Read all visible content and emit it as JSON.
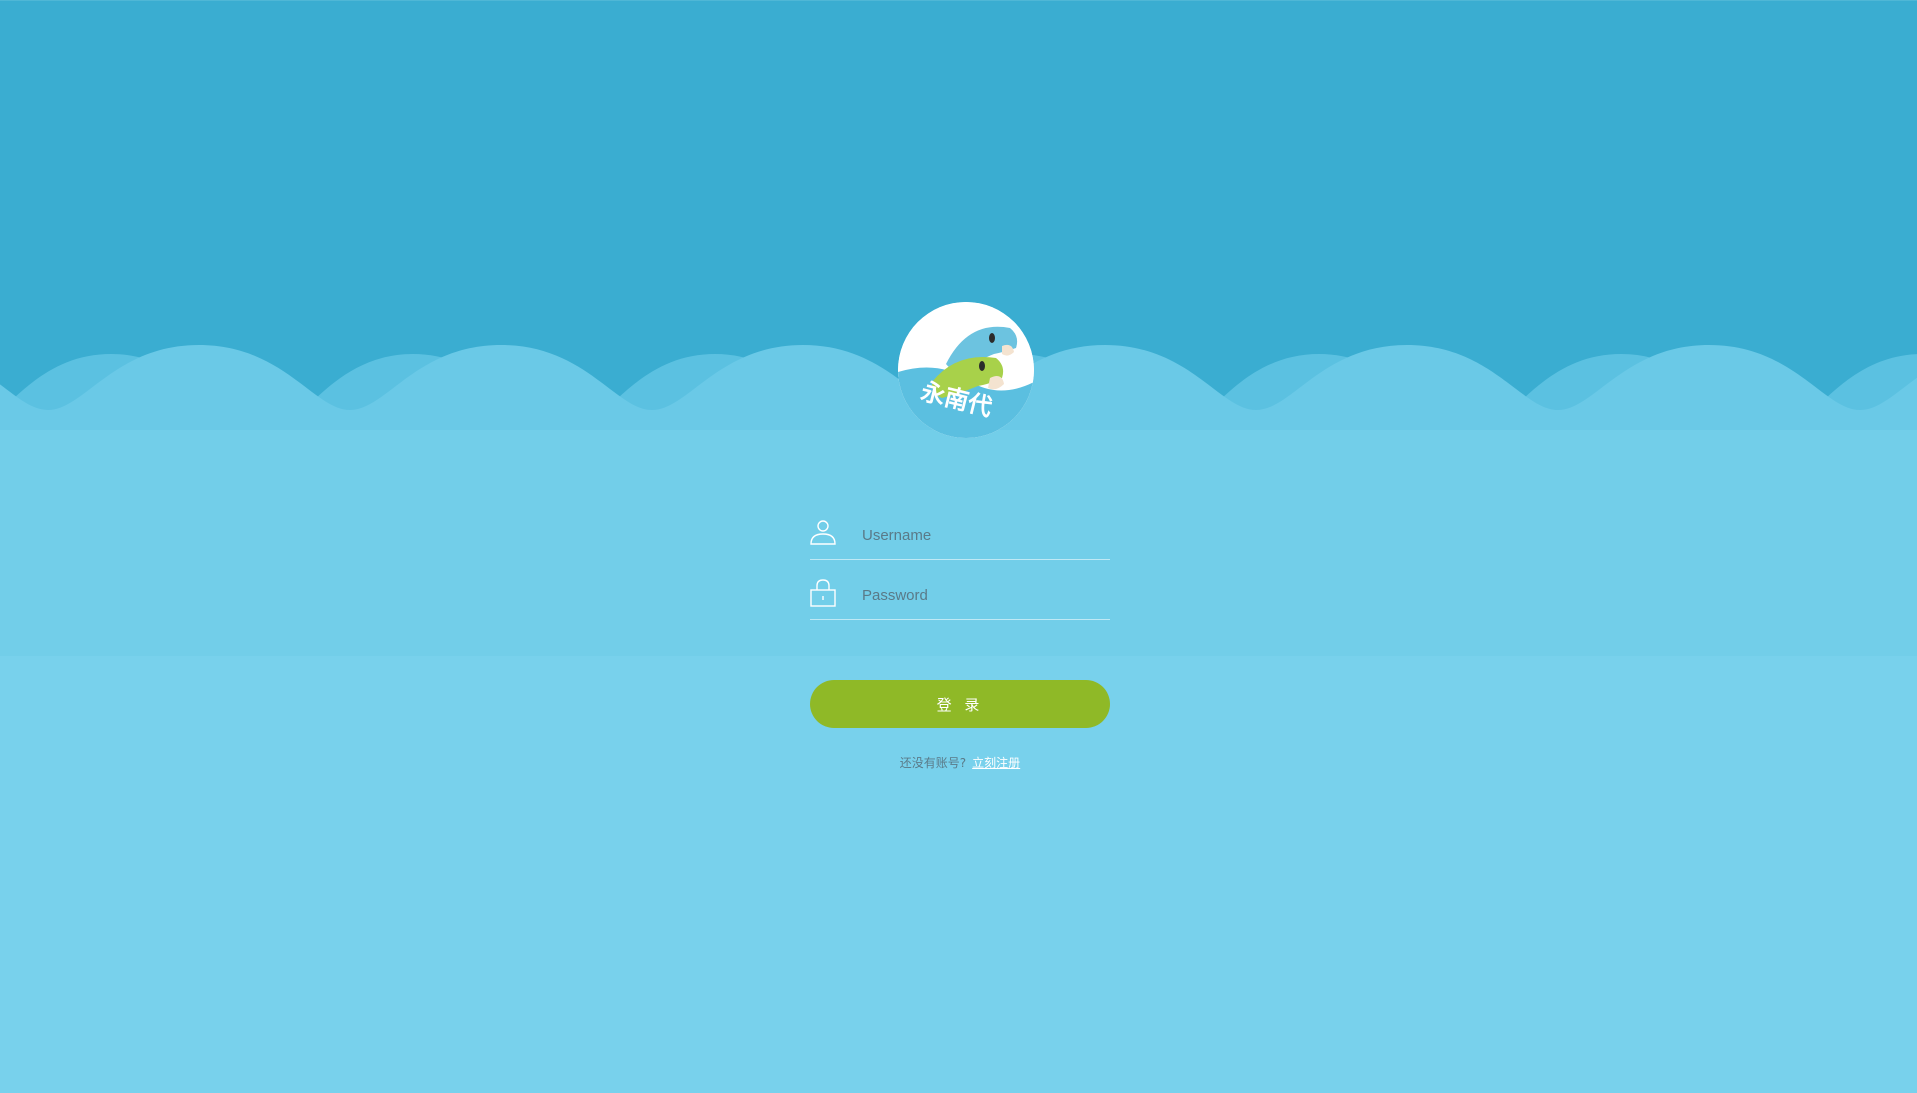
{
  "logo": {
    "icon": "dolphin-logo-icon",
    "text": "永南代"
  },
  "colors": {
    "sky": "#3aadd1",
    "wave": "#68c9e7",
    "sea": "#78d1ec",
    "band": "#72cee9",
    "button": "#8fb927"
  },
  "form": {
    "username": {
      "icon": "user-icon",
      "placeholder": "Username",
      "value": ""
    },
    "password": {
      "icon": "lock-icon",
      "placeholder": "Password",
      "value": ""
    }
  },
  "login_button": {
    "label": "登 录"
  },
  "register": {
    "prompt": "还没有账号?",
    "link": "立刻注册"
  }
}
